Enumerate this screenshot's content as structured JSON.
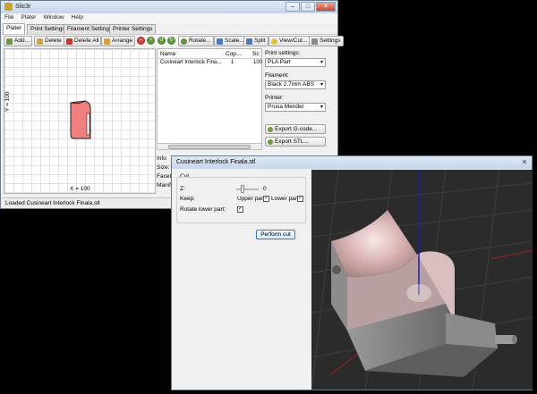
{
  "main_window": {
    "title": "Slic3r",
    "menu": [
      "File",
      "Plater",
      "Window",
      "Help"
    ],
    "tabs": [
      "Plater",
      "Print Settings",
      "Filament Settings",
      "Printer Settings"
    ],
    "toolbar": {
      "add": "Add...",
      "delete": "Delete",
      "delete_all": "Delete All",
      "arrange": "Arrange",
      "rotate": "Rotate...",
      "scale": "Scale...",
      "split": "Split",
      "view_cut": "View/Cut...",
      "settings": "Settings"
    },
    "plater": {
      "y_label": "Y = 100",
      "x_label": "X = 100"
    },
    "object_list": {
      "columns": [
        "Name",
        "Cop...",
        "Sc"
      ],
      "rows": [
        {
          "name": "Cusineart Interlock Fina...",
          "copies": "1",
          "scale": "100"
        }
      ]
    },
    "info": {
      "heading": "Info",
      "labels": [
        "Size:",
        "Facets",
        "Manif"
      ]
    },
    "settings": {
      "print_label": "Print settings:",
      "print_value": "PLA Part",
      "filament_label": "Filament:",
      "filament_value": "Black 2.7mm  ABS",
      "printer_label": "Printer:",
      "printer_value": "Prusa Mendel",
      "export_gcode": "Export G-code...",
      "export_stl": "Export STL..."
    },
    "status": "Loaded Cusineart Interlock Finala.stl"
  },
  "cut_dialog": {
    "title": "Cusineart Interlock Finala.stl",
    "group_label": "Cut",
    "z_label": "Z:",
    "z_value": "0",
    "keep_label": "Keep:",
    "upper_part": "Upper part",
    "upper_checked": true,
    "lower_part": "Lower part",
    "lower_checked": true,
    "rotate_label": "Rotate lower part:",
    "rotate_checked": true,
    "perform_button": "Perform cut"
  },
  "colors": {
    "part_fill": "#f08080",
    "titlebar": "#c7d6ea",
    "viewport_bg": "#2b2b2b",
    "axis_blue": "#1a1ab0"
  }
}
